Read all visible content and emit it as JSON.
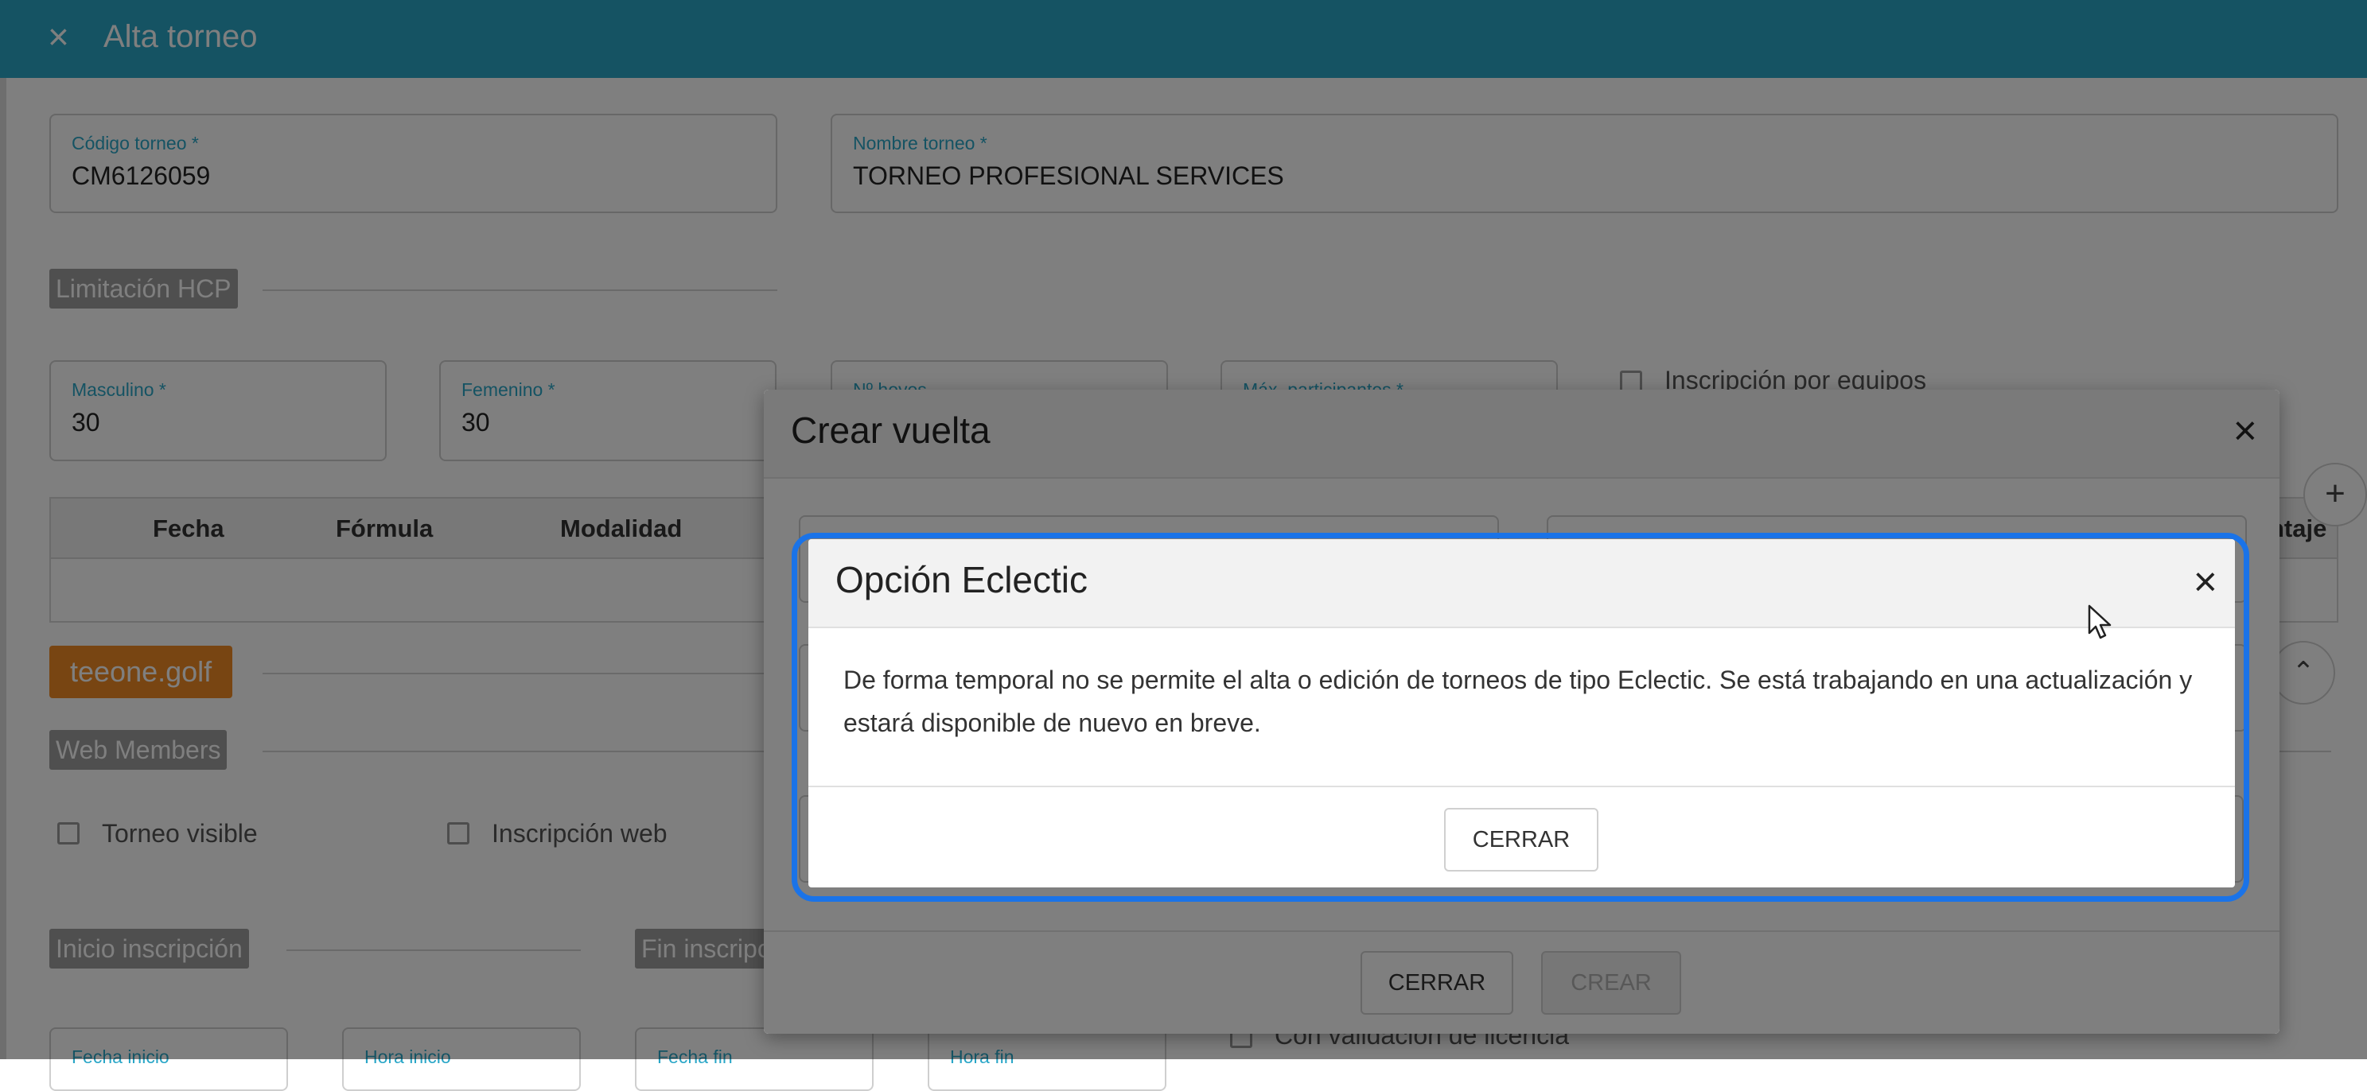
{
  "header": {
    "close_icon": "×",
    "title": "Alta torneo"
  },
  "form": {
    "codigo": {
      "label": "Código torneo *",
      "value": "CM6126059"
    },
    "nombre": {
      "label": "Nombre torneo *",
      "value": "TORNEO PROFESIONAL SERVICES"
    },
    "limitacion_hcp": "Limitación HCP",
    "masculino": {
      "label": "Masculino *",
      "value": "30"
    },
    "femenino": {
      "label": "Femenino *",
      "value": "30"
    },
    "n_hoyos_label": "Nº hoyos",
    "max_participantes_label": "Máx. participantes *",
    "inscripcion_equipos": "Inscripción por equipos",
    "table_headers": [
      "Fecha",
      "Fórmula",
      "Modalidad",
      "ntaje"
    ],
    "teeone_button": "teeone.golf",
    "web_members": "Web Members",
    "torneo_visible": "Torneo visible",
    "inscripcion_web": "Inscripción web",
    "inicio_inscripcion": "Inicio inscripción",
    "fin_inscripcion": "Fin inscripción",
    "fecha_inicio": "Fecha inicio",
    "hora_inicio": "Hora inicio",
    "fecha_fin": "Fecha fin",
    "hora_fin": "Hora fin",
    "validacion_licencia": "Con validación de licencia",
    "add_button": "+",
    "collapse_button": "⌃"
  },
  "crear_vuelta": {
    "title": "Crear vuelta",
    "close_icon": "×",
    "cerrar_label": "CERRAR",
    "crear_label": "CREAR"
  },
  "eclectic_dialog": {
    "title": "Opción Eclectic",
    "close_icon": "×",
    "message": "De forma temporal no se permite el alta o edición de torneos de tipo Eclectic. Se está trabajando en una actualización y estará disponible de nuevo en breve.",
    "cerrar_label": "CERRAR"
  },
  "colors": {
    "header": "#2aa6c7",
    "accent_orange": "#f08a24",
    "focus_ring": "#1a73e8"
  }
}
